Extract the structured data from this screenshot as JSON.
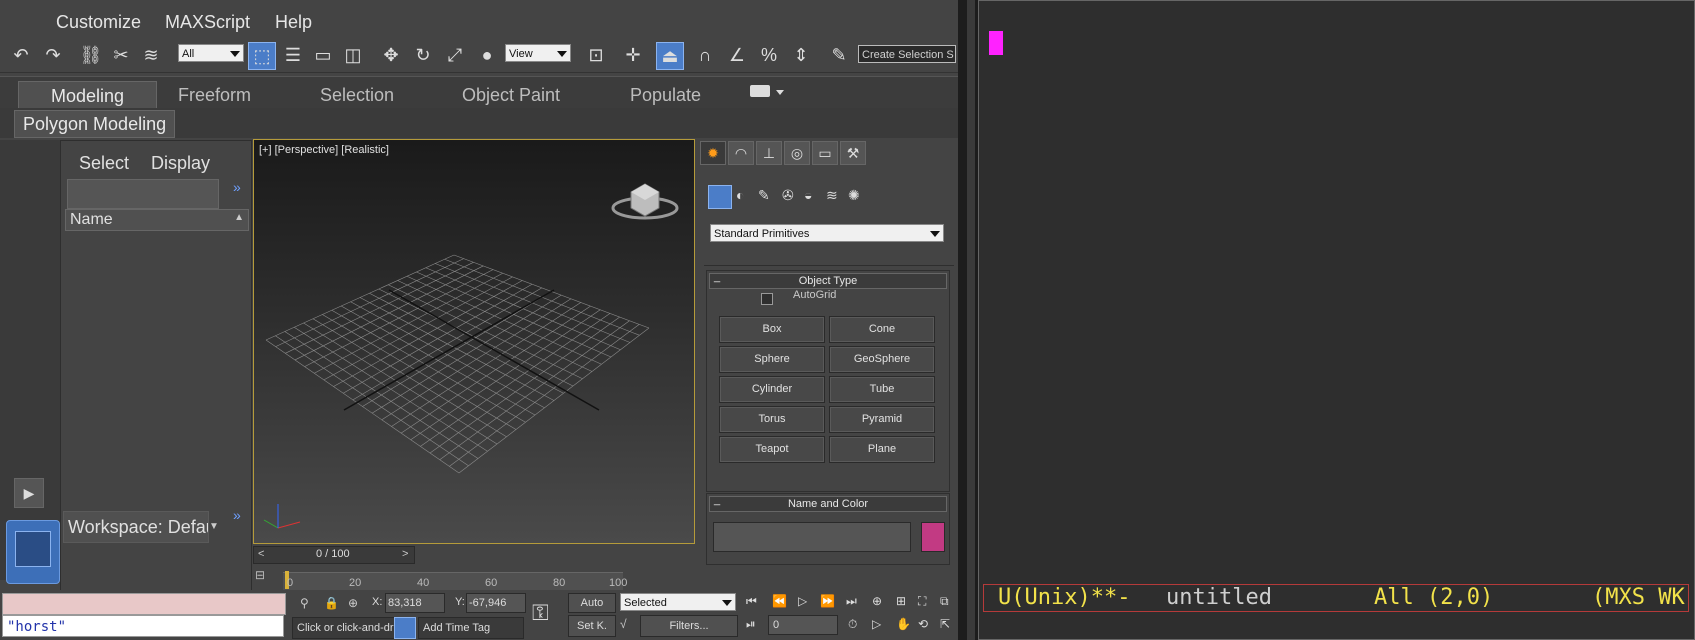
{
  "menu": {
    "items": [
      "Customize",
      "MAXScript",
      "Help"
    ]
  },
  "toolbar": {
    "selection_filter": "All",
    "ref_coord": "View",
    "named_selection_placeholder": "Create Selection S"
  },
  "ribbon": {
    "tabs": [
      "Modeling",
      "Freeform",
      "Selection",
      "Object Paint",
      "Populate"
    ],
    "panel_button": "Polygon Modeling"
  },
  "scene_explorer": {
    "tabs": [
      "Select",
      "Display"
    ],
    "column_header": "Name",
    "workspace": "Workspace: Defau"
  },
  "viewport": {
    "label_plus": "[+]",
    "label_view": "[Perspective]",
    "label_shading": "[Realistic]"
  },
  "command_panel": {
    "dropdown": "Standard Primitives",
    "rollout_object_type": "Object Type",
    "autogrid_label": "AutoGrid",
    "buttons": [
      "Box",
      "Cone",
      "Sphere",
      "GeoSphere",
      "Cylinder",
      "Tube",
      "Torus",
      "Pyramid",
      "Teapot",
      "Plane"
    ],
    "rollout_name_color": "Name and Color",
    "object_color": "#c23a83",
    "collapse_minus": "_"
  },
  "timeline": {
    "frame_counter": "0 / 100",
    "ticks": [
      "0",
      "20",
      "40",
      "60",
      "80",
      "100"
    ]
  },
  "status": {
    "listener_value": "\"horst\"",
    "prompt": "Click or click-and-dr",
    "x_label": "X:",
    "x_value": "83,318",
    "y_label": "Y:",
    "y_value": "-67,946",
    "auto": "Auto",
    "set_key": "Set K.",
    "key_filter": "Selected",
    "filters": "Filters...",
    "frame": "0",
    "add_time_tag": "Add Time Tag"
  },
  "editor": {
    "modeline_left": "U(Unix)**-",
    "buffer_name": "untitled",
    "position": "All (2,0)",
    "mode": "(MXS WK",
    "cursor_color": "#ff22ff"
  }
}
